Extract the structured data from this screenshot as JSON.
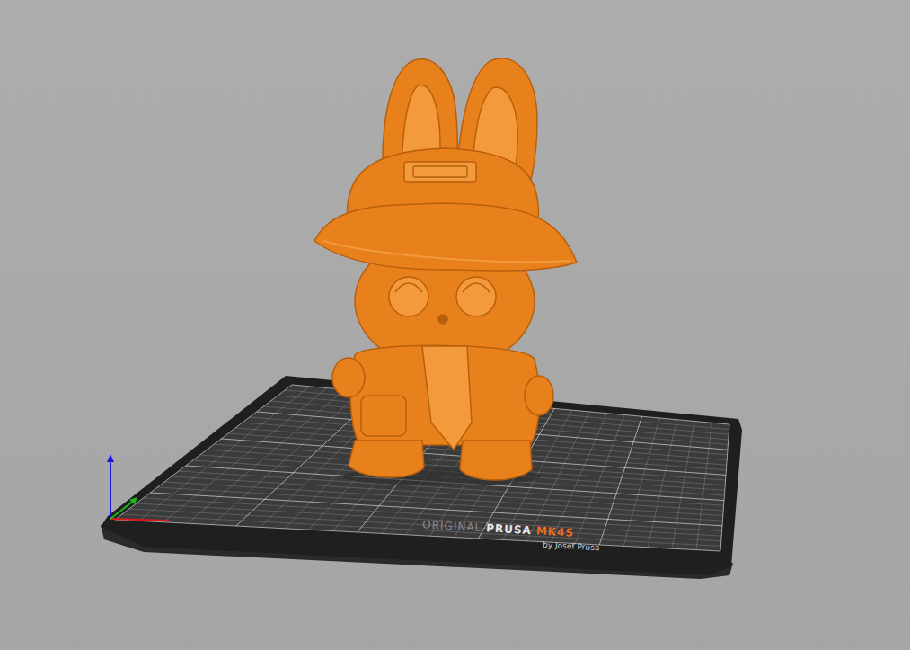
{
  "viewport": {
    "kind": "3d-preview",
    "model": "figure"
  },
  "bed": {
    "logo_prefix": "ORIGINAL",
    "logo_brand": "PRUSA",
    "logo_model": "MK4S",
    "byline": "by Josef Prusa"
  }
}
